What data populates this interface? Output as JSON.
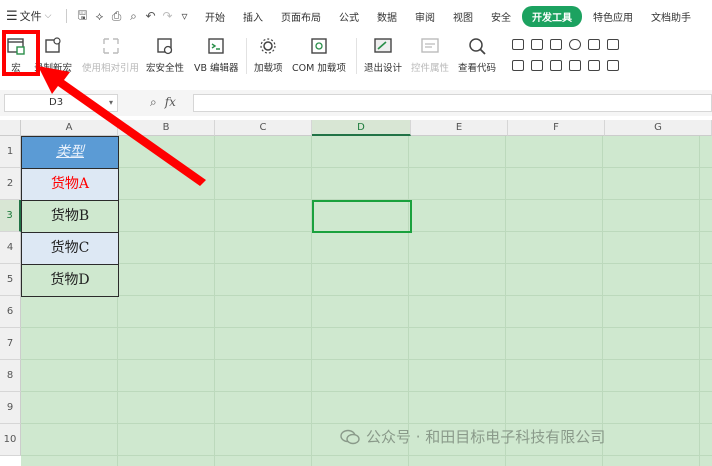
{
  "menubar": {
    "file_label": "文件",
    "tabs": [
      "开始",
      "插入",
      "页面布局",
      "公式",
      "数据",
      "审阅",
      "视图",
      "安全",
      "开发工具",
      "特色应用",
      "文档助手"
    ],
    "active_tab": "开发工具",
    "active_color": "#1ca260"
  },
  "ribbon": {
    "macro": "宏",
    "record_macro": "录制新宏",
    "relative_ref": "使用相对引用",
    "macro_security": "宏安全性",
    "vb_editor": "VB 编辑器",
    "addins": "加载项",
    "com_addins": "COM 加载项",
    "exit_design": "退出设计",
    "control_props": "控件属性",
    "view_code": "查看代码"
  },
  "formula_bar": {
    "name_box": "D3",
    "fx_label": "fx",
    "formula": ""
  },
  "sheet": {
    "columns": [
      "A",
      "B",
      "C",
      "D",
      "E",
      "F",
      "G"
    ],
    "rows": [
      "1",
      "2",
      "3",
      "4",
      "5",
      "6",
      "7",
      "8",
      "9",
      "10"
    ],
    "active_column": "D",
    "active_row": "3",
    "cells": {
      "A1": "类型",
      "A2": "货物A",
      "A3": "货物B",
      "A4": "货物C",
      "A5": "货物D"
    },
    "colors": {
      "header_fill": "#5b9bd5",
      "alt_fill": "#dde8f4",
      "red_text": "#ff0000",
      "sheet_bg": "#cfe8cf"
    }
  },
  "watermark": "公众号 · 和田目标电子科技有限公司"
}
